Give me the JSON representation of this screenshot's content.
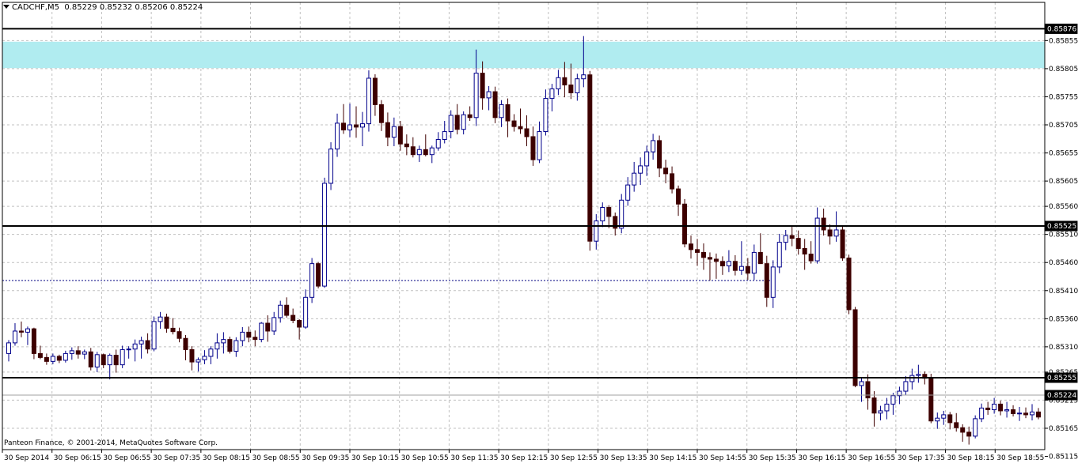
{
  "header": {
    "symbol": "CADCHF,M5",
    "ohlc": "0.85229 0.85232 0.85206 0.85224"
  },
  "copyright": "Panteon Finance, © 2001-2014, MetaQuotes Software Corp.",
  "colors": {
    "background": "#ffffff",
    "grid": "#c0c0c0",
    "bull_body_fill": "#ffffff",
    "bull_outline": "#00008b",
    "bear_body_fill": "#3c0000",
    "bear_outline": "#400000",
    "zone_fill": "#b0ecf0",
    "h_line": "#000000",
    "dotted_line": "#000080",
    "current_price_line": "#a0a0a0"
  },
  "chart_data": {
    "type": "candlestick",
    "title": "CADCHF,M5",
    "ylim": [
      0.85127,
      0.85923
    ],
    "y_ticks": [
      "0.85855",
      "0.85805",
      "0.85755",
      "0.85705",
      "0.85655",
      "0.85605",
      "0.85560",
      "0.85510",
      "0.85460",
      "0.85410",
      "0.85360",
      "0.85310",
      "0.85265",
      "0.85215",
      "0.85165",
      "0.85115"
    ],
    "x_ticks": [
      "30 Sep 2014",
      "30 Sep 06:15",
      "30 Sep 06:55",
      "30 Sep 07:35",
      "30 Sep 08:15",
      "30 Sep 08:55",
      "30 Sep 09:35",
      "30 Sep 10:15",
      "30 Sep 10:55",
      "30 Sep 11:35",
      "30 Sep 12:15",
      "30 Sep 12:55",
      "30 Sep 13:35",
      "30 Sep 14:15",
      "30 Sep 14:55",
      "30 Sep 15:35",
      "30 Sep 16:15",
      "30 Sep 16:55",
      "30 Sep 17:35",
      "30 Sep 18:15",
      "30 Sep 18:55"
    ],
    "grid": true,
    "levels": [
      {
        "price": 0.85876,
        "label": "0.85876"
      },
      {
        "price": 0.85525,
        "label": "0.85525"
      },
      {
        "price": 0.85255,
        "label": "0.85255"
      }
    ],
    "current_price": {
      "price": 0.85224,
      "label": "0.85224"
    },
    "zone": {
      "from": 0.85806,
      "to": 0.85853
    },
    "dotted_line": {
      "price": 0.85428
    },
    "candles": [
      [
        0.85298,
        0.85322,
        0.85284,
        0.85317
      ],
      [
        0.85317,
        0.85352,
        0.85312,
        0.85338
      ],
      [
        0.85338,
        0.85355,
        0.85327,
        0.85336
      ],
      [
        0.85336,
        0.85346,
        0.85313,
        0.85342
      ],
      [
        0.85342,
        0.85344,
        0.85288,
        0.85298
      ],
      [
        0.85298,
        0.85312,
        0.85288,
        0.85291
      ],
      [
        0.85291,
        0.85298,
        0.85278,
        0.85284
      ],
      [
        0.85284,
        0.85298,
        0.85279,
        0.85293
      ],
      [
        0.85293,
        0.85296,
        0.85281,
        0.85286
      ],
      [
        0.85286,
        0.85303,
        0.85282,
        0.85298
      ],
      [
        0.85298,
        0.85309,
        0.85287,
        0.85303
      ],
      [
        0.85303,
        0.85311,
        0.85289,
        0.85297
      ],
      [
        0.85297,
        0.85305,
        0.85288,
        0.85301
      ],
      [
        0.85301,
        0.85308,
        0.85268,
        0.85274
      ],
      [
        0.85274,
        0.85301,
        0.85265,
        0.85296
      ],
      [
        0.85296,
        0.85298,
        0.85272,
        0.85278
      ],
      [
        0.85278,
        0.85298,
        0.85252,
        0.85295
      ],
      [
        0.85295,
        0.85305,
        0.85264,
        0.85278
      ],
      [
        0.85278,
        0.85312,
        0.85272,
        0.85305
      ],
      [
        0.85305,
        0.85311,
        0.85289,
        0.85306
      ],
      [
        0.85306,
        0.85323,
        0.85284,
        0.85315
      ],
      [
        0.85315,
        0.85328,
        0.85289,
        0.85321
      ],
      [
        0.85321,
        0.85334,
        0.85298,
        0.85306
      ],
      [
        0.85306,
        0.85364,
        0.85302,
        0.85355
      ],
      [
        0.85355,
        0.85372,
        0.85342,
        0.85363
      ],
      [
        0.85363,
        0.85369,
        0.85335,
        0.85343
      ],
      [
        0.85343,
        0.85361,
        0.85332,
        0.85337
      ],
      [
        0.85337,
        0.85344,
        0.85318,
        0.85325
      ],
      [
        0.85325,
        0.85331,
        0.85286,
        0.85305
      ],
      [
        0.85305,
        0.85311,
        0.85268,
        0.85283
      ],
      [
        0.85283,
        0.85291,
        0.85266,
        0.85287
      ],
      [
        0.85287,
        0.85304,
        0.85279,
        0.85293
      ],
      [
        0.85293,
        0.85311,
        0.85279,
        0.85306
      ],
      [
        0.85306,
        0.85334,
        0.85289,
        0.85317
      ],
      [
        0.85317,
        0.85336,
        0.85298,
        0.85323
      ],
      [
        0.85323,
        0.85328,
        0.85298,
        0.85302
      ],
      [
        0.85302,
        0.85327,
        0.85292,
        0.85321
      ],
      [
        0.85321,
        0.85345,
        0.85311,
        0.85336
      ],
      [
        0.85336,
        0.85346,
        0.85318,
        0.85327
      ],
      [
        0.85327,
        0.85339,
        0.85311,
        0.85323
      ],
      [
        0.85323,
        0.85354,
        0.85318,
        0.85352
      ],
      [
        0.85352,
        0.85366,
        0.85319,
        0.85338
      ],
      [
        0.85338,
        0.85372,
        0.85331,
        0.85362
      ],
      [
        0.85362,
        0.85392,
        0.85353,
        0.85384
      ],
      [
        0.85384,
        0.85398,
        0.85362,
        0.85366
      ],
      [
        0.85366,
        0.85378,
        0.85352,
        0.85357
      ],
      [
        0.85357,
        0.85359,
        0.85323,
        0.85345
      ],
      [
        0.85345,
        0.85412,
        0.85342,
        0.85398
      ],
      [
        0.85398,
        0.85468,
        0.85388,
        0.85458
      ],
      [
        0.85458,
        0.85461,
        0.85414,
        0.85418
      ],
      [
        0.85418,
        0.85611,
        0.85415,
        0.85601
      ],
      [
        0.85601,
        0.85674,
        0.85589,
        0.85662
      ],
      [
        0.85662,
        0.85725,
        0.85648,
        0.85708
      ],
      [
        0.85708,
        0.85742,
        0.85689,
        0.85696
      ],
      [
        0.85696,
        0.85743,
        0.85683,
        0.85705
      ],
      [
        0.85705,
        0.85738,
        0.85682,
        0.85701
      ],
      [
        0.85701,
        0.85728,
        0.85667,
        0.85707
      ],
      [
        0.85707,
        0.85802,
        0.85693,
        0.85788
      ],
      [
        0.85788,
        0.85795,
        0.85721,
        0.85741
      ],
      [
        0.85741,
        0.85749,
        0.85694,
        0.85709
      ],
      [
        0.85709,
        0.85727,
        0.85667,
        0.85683
      ],
      [
        0.85683,
        0.85718,
        0.85667,
        0.85702
      ],
      [
        0.85702,
        0.85712,
        0.85659,
        0.85671
      ],
      [
        0.85671,
        0.85688,
        0.85651,
        0.85666
      ],
      [
        0.85666,
        0.85683,
        0.85647,
        0.85652
      ],
      [
        0.85652,
        0.85668,
        0.85639,
        0.85661
      ],
      [
        0.85661,
        0.85688,
        0.85649,
        0.85652
      ],
      [
        0.85652,
        0.85668,
        0.85637,
        0.85664
      ],
      [
        0.85664,
        0.85692,
        0.85659,
        0.85679
      ],
      [
        0.85679,
        0.85712,
        0.85672,
        0.85693
      ],
      [
        0.85693,
        0.85731,
        0.85681,
        0.85722
      ],
      [
        0.85722,
        0.85742,
        0.85688,
        0.85697
      ],
      [
        0.85697,
        0.85729,
        0.85688,
        0.85723
      ],
      [
        0.85723,
        0.85738,
        0.85712,
        0.85718
      ],
      [
        0.85718,
        0.85839,
        0.85703,
        0.85797
      ],
      [
        0.85797,
        0.85818,
        0.85732,
        0.85753
      ],
      [
        0.85753,
        0.85774,
        0.85731,
        0.85764
      ],
      [
        0.85764,
        0.85773,
        0.85708,
        0.85718
      ],
      [
        0.85718,
        0.85749,
        0.85701,
        0.85741
      ],
      [
        0.85741,
        0.85752,
        0.85683,
        0.85712
      ],
      [
        0.85712,
        0.85724,
        0.85693,
        0.85702
      ],
      [
        0.85702,
        0.85734,
        0.85689,
        0.85698
      ],
      [
        0.85698,
        0.85722,
        0.85667,
        0.85684
      ],
      [
        0.85684,
        0.85702,
        0.85632,
        0.85643
      ],
      [
        0.85643,
        0.85711,
        0.85637,
        0.85693
      ],
      [
        0.85693,
        0.85768,
        0.85686,
        0.85752
      ],
      [
        0.85752,
        0.85778,
        0.85729,
        0.85769
      ],
      [
        0.85769,
        0.85803,
        0.85758,
        0.85789
      ],
      [
        0.85789,
        0.85817,
        0.85754,
        0.85776
      ],
      [
        0.85776,
        0.85814,
        0.85751,
        0.85762
      ],
      [
        0.85762,
        0.85796,
        0.85748,
        0.85787
      ],
      [
        0.85787,
        0.85863,
        0.85772,
        0.85794
      ],
      [
        0.85794,
        0.85801,
        0.85481,
        0.85498
      ],
      [
        0.85498,
        0.85546,
        0.85483,
        0.85534
      ],
      [
        0.85534,
        0.85567,
        0.85523,
        0.85558
      ],
      [
        0.85558,
        0.85562,
        0.85521,
        0.85542
      ],
      [
        0.85542,
        0.85549,
        0.85508,
        0.85521
      ],
      [
        0.85521,
        0.85582,
        0.85512,
        0.85571
      ],
      [
        0.85571,
        0.85612,
        0.85561,
        0.85598
      ],
      [
        0.85598,
        0.85639,
        0.85586,
        0.85619
      ],
      [
        0.85619,
        0.85647,
        0.85598,
        0.85632
      ],
      [
        0.85632,
        0.85668,
        0.85614,
        0.85657
      ],
      [
        0.85657,
        0.85689,
        0.85643,
        0.85677
      ],
      [
        0.85677,
        0.85686,
        0.85612,
        0.85628
      ],
      [
        0.85628,
        0.85643,
        0.85601,
        0.85618
      ],
      [
        0.85618,
        0.85631,
        0.85583,
        0.85591
      ],
      [
        0.85591,
        0.85597,
        0.85543,
        0.85564
      ],
      [
        0.85564,
        0.85573,
        0.85487,
        0.85493
      ],
      [
        0.85493,
        0.85508,
        0.85467,
        0.85483
      ],
      [
        0.85483,
        0.85502,
        0.85454,
        0.85478
      ],
      [
        0.85478,
        0.85494,
        0.85447,
        0.85469
      ],
      [
        0.85469,
        0.85478,
        0.85428,
        0.85466
      ],
      [
        0.85466,
        0.85476,
        0.85431,
        0.85462
      ],
      [
        0.85462,
        0.85471,
        0.85438,
        0.85454
      ],
      [
        0.85454,
        0.85482,
        0.85443,
        0.85462
      ],
      [
        0.85462,
        0.85473,
        0.85437,
        0.85446
      ],
      [
        0.85446,
        0.85498,
        0.85438,
        0.85453
      ],
      [
        0.85453,
        0.85468,
        0.85429,
        0.85441
      ],
      [
        0.85441,
        0.85492,
        0.85429,
        0.85478
      ],
      [
        0.85478,
        0.85512,
        0.85462,
        0.85458
      ],
      [
        0.85458,
        0.85472,
        0.85381,
        0.85398
      ],
      [
        0.85398,
        0.85464,
        0.85379,
        0.85452
      ],
      [
        0.85452,
        0.85511,
        0.85441,
        0.85496
      ],
      [
        0.85496,
        0.85518,
        0.85482,
        0.85508
      ],
      [
        0.85508,
        0.85524,
        0.85489,
        0.85503
      ],
      [
        0.85503,
        0.85517,
        0.85474,
        0.85485
      ],
      [
        0.85485,
        0.85502,
        0.85447,
        0.85475
      ],
      [
        0.85475,
        0.85498,
        0.85458,
        0.85463
      ],
      [
        0.85463,
        0.85558,
        0.85458,
        0.85539
      ],
      [
        0.85539,
        0.85556,
        0.85508,
        0.85518
      ],
      [
        0.85518,
        0.85528,
        0.85492,
        0.85507
      ],
      [
        0.85507,
        0.85551,
        0.85497,
        0.85518
      ],
      [
        0.85518,
        0.85524,
        0.85463,
        0.85468
      ],
      [
        0.85468,
        0.85474,
        0.85368,
        0.85376
      ],
      [
        0.85376,
        0.85381,
        0.85238,
        0.85241
      ],
      [
        0.85241,
        0.85256,
        0.85212,
        0.85248
      ],
      [
        0.85248,
        0.85261,
        0.85198,
        0.85219
      ],
      [
        0.85219,
        0.85231,
        0.85168,
        0.85192
      ],
      [
        0.85192,
        0.85205,
        0.85179,
        0.85196
      ],
      [
        0.85196,
        0.85219,
        0.85181,
        0.85208
      ],
      [
        0.85208,
        0.85228,
        0.85189,
        0.85223
      ],
      [
        0.85223,
        0.85239,
        0.85208,
        0.85231
      ],
      [
        0.85231,
        0.85258,
        0.85224,
        0.85248
      ],
      [
        0.85248,
        0.85271,
        0.85234,
        0.85259
      ],
      [
        0.85259,
        0.85278,
        0.85246,
        0.85261
      ],
      [
        0.85261,
        0.85266,
        0.85243,
        0.85254
      ],
      [
        0.85254,
        0.85262,
        0.85174,
        0.85178
      ],
      [
        0.85178,
        0.85193,
        0.85164,
        0.85183
      ],
      [
        0.85183,
        0.85196,
        0.85171,
        0.85189
      ],
      [
        0.85189,
        0.85194,
        0.85163,
        0.85175
      ],
      [
        0.85175,
        0.85192,
        0.85159,
        0.85166
      ],
      [
        0.85166,
        0.85172,
        0.85141,
        0.85158
      ],
      [
        0.85158,
        0.85168,
        0.85136,
        0.85151
      ],
      [
        0.85151,
        0.85188,
        0.85147,
        0.85182
      ],
      [
        0.85182,
        0.85209,
        0.85176,
        0.85201
      ],
      [
        0.85201,
        0.85212,
        0.85189,
        0.85198
      ],
      [
        0.85198,
        0.85219,
        0.85191,
        0.85208
      ],
      [
        0.85208,
        0.85214,
        0.85188,
        0.85196
      ],
      [
        0.85196,
        0.85212,
        0.85184,
        0.85198
      ],
      [
        0.85198,
        0.85206,
        0.85186,
        0.85191
      ],
      [
        0.85191,
        0.85203,
        0.85178,
        0.85192
      ],
      [
        0.85192,
        0.85202,
        0.85183,
        0.85189
      ],
      [
        0.85189,
        0.85208,
        0.85179,
        0.85194
      ],
      [
        0.85194,
        0.85201,
        0.85181,
        0.85185
      ]
    ]
  }
}
